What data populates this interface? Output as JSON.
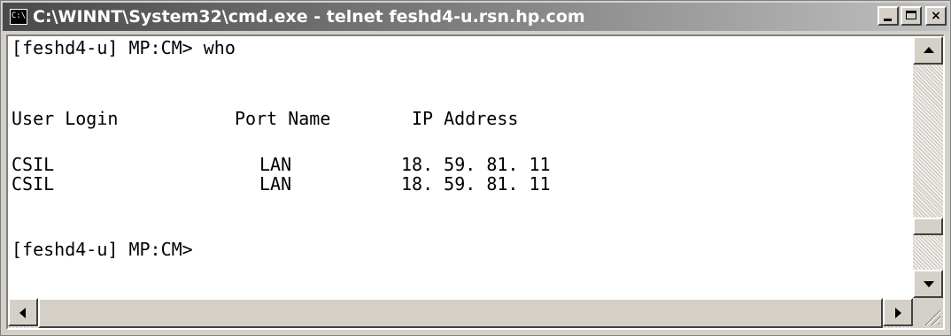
{
  "window": {
    "title": "C:\\WINNT\\System32\\cmd.exe - telnet feshd4-u.rsn.hp.com",
    "icon_text": "C:\\",
    "controls": [
      "minimize-icon",
      "maximize-icon",
      "close-icon"
    ],
    "close_label": "×"
  },
  "console": {
    "command_line": "[feshd4-u] MP:CM> who",
    "headers": {
      "user_login": "User Login",
      "port_name": "Port Name",
      "ip_address": "IP Address"
    },
    "rows": [
      {
        "user": "CSIL",
        "port": "LAN",
        "ip": "18. 59. 81. 11"
      },
      {
        "user": "CSIL",
        "port": "LAN",
        "ip": "18. 59. 81. 11"
      }
    ],
    "prompt": "[feshd4-u] MP:CM>"
  },
  "colors": {
    "console_background": "#ffffff",
    "console_text": "#000000",
    "titlebar_start": "#4a4a4a",
    "titlebar_end": "#c0c0c0",
    "chrome": "#d4d0c8"
  }
}
